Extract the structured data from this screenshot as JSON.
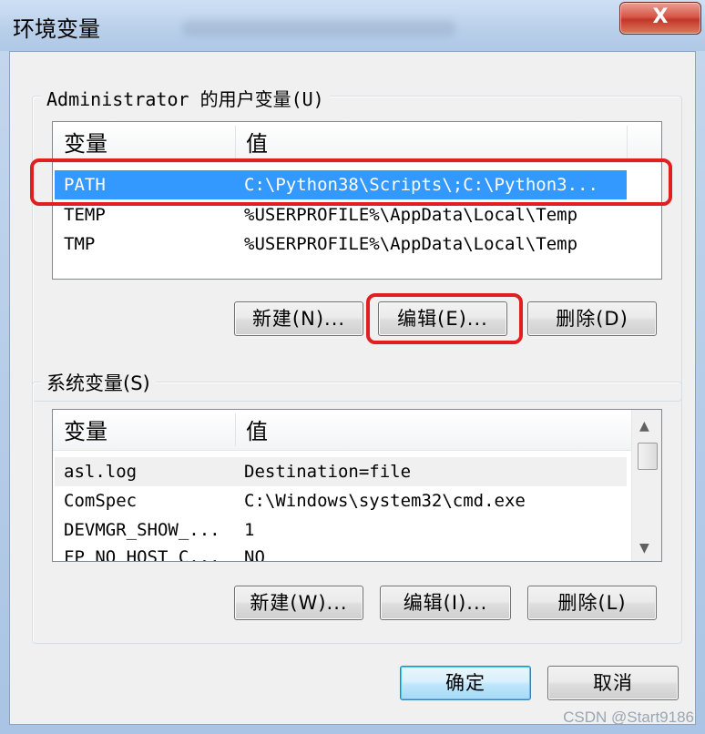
{
  "window": {
    "title": "环境变量",
    "close_glyph": "X"
  },
  "user_vars": {
    "group_label": "Administrator 的用户变量(U)",
    "col_var": "变量",
    "col_val": "值",
    "rows": [
      {
        "name": "PATH",
        "value": "C:\\Python38\\Scripts\\;C:\\Python3...",
        "selected": true
      },
      {
        "name": "TEMP",
        "value": "%USERPROFILE%\\AppData\\Local\\Temp"
      },
      {
        "name": "TMP",
        "value": "%USERPROFILE%\\AppData\\Local\\Temp"
      }
    ],
    "buttons": {
      "new": "新建(N)...",
      "edit": "编辑(E)...",
      "delete": "删除(D)"
    }
  },
  "system_vars": {
    "group_label": "系统变量(S)",
    "col_var": "变量",
    "col_val": "值",
    "rows": [
      {
        "name": "asl.log",
        "value": "Destination=file",
        "selected": true
      },
      {
        "name": "ComSpec",
        "value": "C:\\Windows\\system32\\cmd.exe"
      },
      {
        "name": "DEVMGR_SHOW_...",
        "value": "1"
      },
      {
        "name": "FP_NO_HOST_C...",
        "value": "NO"
      }
    ],
    "buttons": {
      "new": "新建(W)...",
      "edit": "编辑(I)...",
      "delete": "删除(L)"
    }
  },
  "footer": {
    "ok": "确定",
    "cancel": "取消"
  },
  "watermark": "CSDN @Start9186",
  "colors": {
    "selection": "#3399ff",
    "highlight": "#e02020"
  }
}
